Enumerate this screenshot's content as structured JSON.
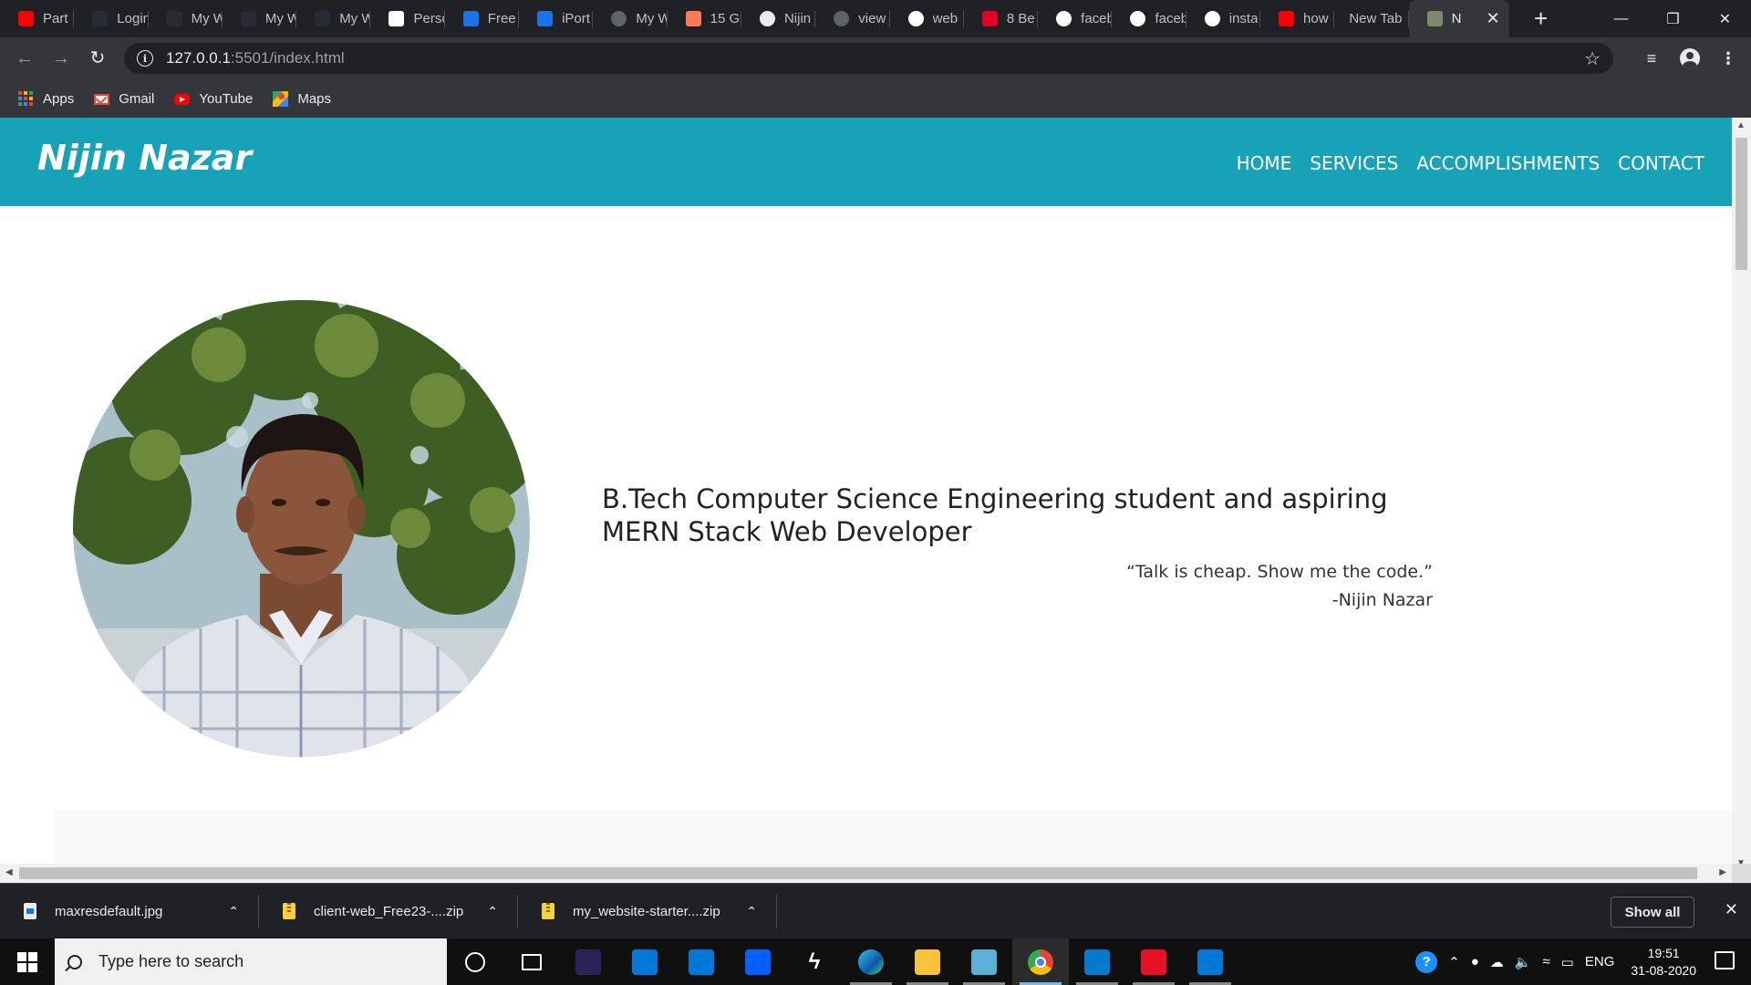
{
  "browser": {
    "tabs": [
      {
        "title": "Part",
        "icon": "youtube-icon",
        "color": "#ff0000"
      },
      {
        "title": "Login",
        "icon": "w3schools-icon",
        "color": "#282a35"
      },
      {
        "title": "My W",
        "icon": "w3schools-icon",
        "color": "#282a35"
      },
      {
        "title": "My W",
        "icon": "w3schools-icon",
        "color": "#282a35"
      },
      {
        "title": "My W",
        "icon": "w3schools-icon",
        "color": "#282a35"
      },
      {
        "title": "Perso",
        "icon": "wix-icon",
        "color": "#ffffff"
      },
      {
        "title": "Free",
        "icon": "flow-icon",
        "color": "#1a73e8"
      },
      {
        "title": "iPort",
        "icon": "flow-icon",
        "color": "#1a73e8"
      },
      {
        "title": "My W",
        "icon": "globe-icon",
        "color": "#5f6368"
      },
      {
        "title": "15 G",
        "icon": "hubspot-icon",
        "color": "#ff7a59"
      },
      {
        "title": "Nijin",
        "icon": "globe-icon",
        "color": "#e8eaed"
      },
      {
        "title": "view",
        "icon": "globe-icon",
        "color": "#5f6368"
      },
      {
        "title": "web",
        "icon": "google-icon",
        "color": "#ffffff"
      },
      {
        "title": "8 Be",
        "icon": "pinterest-icon",
        "color": "#e60023"
      },
      {
        "title": "faceb",
        "icon": "google-icon",
        "color": "#ffffff"
      },
      {
        "title": "faceb",
        "icon": "google-icon",
        "color": "#ffffff"
      },
      {
        "title": "insta",
        "icon": "google-icon",
        "color": "#ffffff"
      },
      {
        "title": "how",
        "icon": "youtube-icon",
        "color": "#ff0000"
      },
      {
        "title": "New Tab",
        "icon": "",
        "color": ""
      }
    ],
    "active_tab": {
      "title": "N"
    },
    "url_host": "127.0.0.1",
    "url_rest": ":5501/index.html",
    "bookmarks": [
      {
        "label": "Apps",
        "icon": "apps-grid-icon"
      },
      {
        "label": "Gmail",
        "icon": "gmail-icon"
      },
      {
        "label": "YouTube",
        "icon": "youtube-icon"
      },
      {
        "label": "Maps",
        "icon": "maps-icon"
      }
    ]
  },
  "site": {
    "brand": "Nijin Nazar",
    "nav": [
      "HOME",
      "SERVICES",
      "ACCOMPLISHMENTS",
      "CONTACT"
    ],
    "accent_color": "#17a2b8",
    "headline": "B.Tech Computer Science Engineering student and aspiring MERN Stack Web Developer",
    "quote": "“Talk is cheap. Show me the code.”",
    "quote_author": "-Nijin Nazar"
  },
  "downloads": {
    "items": [
      {
        "name": "maxresdefault.jpg",
        "type": "image"
      },
      {
        "name": "client-web_Free23-....zip",
        "type": "zip"
      },
      {
        "name": "my_website-starter....zip",
        "type": "zip"
      }
    ],
    "show_all": "Show all"
  },
  "taskbar": {
    "search_placeholder": "Type here to search",
    "apps": [
      {
        "name": "cortana",
        "color": "#ffffff"
      },
      {
        "name": "task-view",
        "color": "#ffffff"
      },
      {
        "name": "eclipse",
        "color": "#2c2255"
      },
      {
        "name": "microsoft-store",
        "color": "#0078d7"
      },
      {
        "name": "mail",
        "color": "#0078d7"
      },
      {
        "name": "dropbox",
        "color": "#0061ff"
      },
      {
        "name": "winamp",
        "color": "#ffffff"
      },
      {
        "name": "edge",
        "color": "#0c8fd6"
      },
      {
        "name": "file-explorer",
        "color": "#f8c33b"
      },
      {
        "name": "notepad",
        "color": "#5ab0d8"
      },
      {
        "name": "chrome",
        "color": "#4285f4"
      },
      {
        "name": "vscode",
        "color": "#007acc"
      },
      {
        "name": "whatsapp",
        "color": "#e81123"
      },
      {
        "name": "photos",
        "color": "#0078d7"
      }
    ],
    "language": "ENG",
    "time": "19:51",
    "date": "31-08-2020"
  }
}
